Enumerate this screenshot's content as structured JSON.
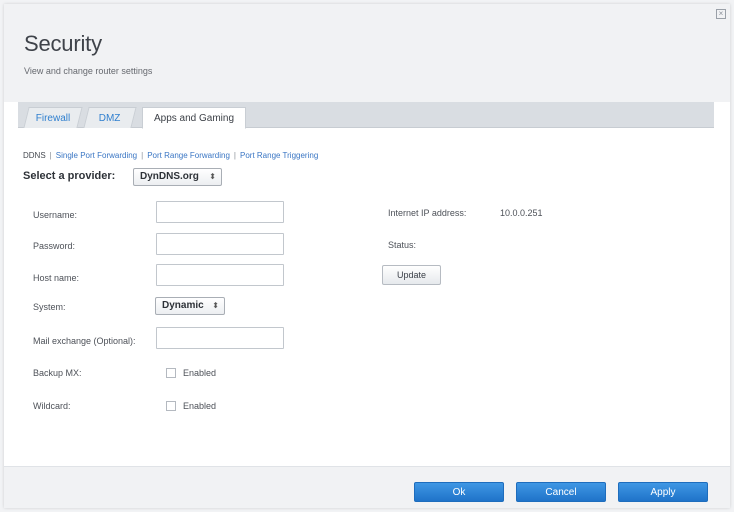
{
  "header": {
    "title": "Security",
    "subtitle": "View and change router settings",
    "close_icon": "close-icon"
  },
  "tabs": [
    {
      "label": "Firewall",
      "active": false
    },
    {
      "label": "DMZ",
      "active": false
    },
    {
      "label": "Apps and Gaming",
      "active": true
    }
  ],
  "subnav": {
    "items": [
      "DDNS",
      "Single Port Forwarding",
      "Port Range Forwarding",
      "Port Range Triggering"
    ],
    "current": "DDNS"
  },
  "provider": {
    "label": "Select a provider:",
    "selected": "DynDNS.org"
  },
  "form": {
    "username_label": "Username:",
    "password_label": "Password:",
    "hostname_label": "Host name:",
    "system_label": "System:",
    "system_value": "Dynamic",
    "mail_label": "Mail exchange (Optional):",
    "backup_label": "Backup MX:",
    "backup_cb": "Enabled",
    "wildcard_label": "Wildcard:",
    "wildcard_cb": "Enabled",
    "username_value": "",
    "password_value": "",
    "hostname_value": "",
    "mail_value": ""
  },
  "status_panel": {
    "ip_label": "Internet IP address:",
    "ip_value": "10.0.0.251",
    "status_label": "Status:",
    "update_label": "Update"
  },
  "footer": {
    "ok_label": "Ok",
    "cancel_label": "Cancel",
    "apply_label": "Apply"
  },
  "colors": {
    "accent": "#2f7fcf",
    "button": "#2a80d6",
    "link": "#3a76c4"
  }
}
